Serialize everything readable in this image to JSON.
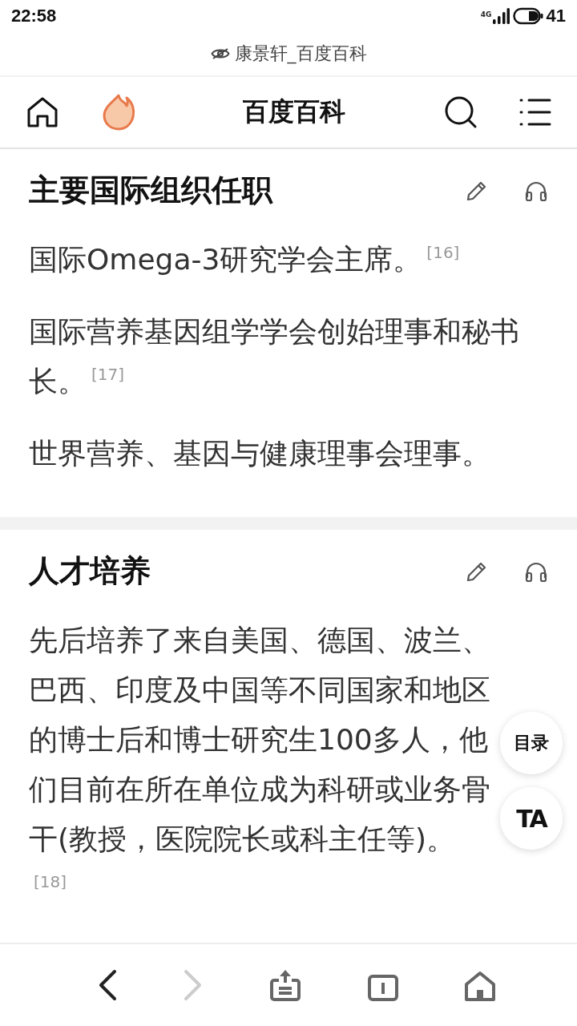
{
  "status_bar": {
    "time": "22:58",
    "network": "4G",
    "battery": "41"
  },
  "page_title": "康景轩_百度百科",
  "nav": {
    "title": "百度百科"
  },
  "sections": [
    {
      "heading": "主要国际组织任职",
      "paragraphs": [
        "国际Omega-3研究学会主席。$^{[16]}$",
        "国际营养基因组学学会创始理事和秘书长。$^{[17]}$",
        "世界营养、基因与健康理事会理事。"
      ]
    },
    {
      "heading": "人才培养",
      "paragraphs": [
        "先后培养了来自美国、德国、波兰、巴西、印度及中国等不同国家和地区的博士后和博士研究生100多人，他们目前在所在单位成为科研或业务骨干(教授，医院院长或科主任等)。$^{[18]}$"
      ]
    }
  ],
  "floating_buttons": [
    {
      "kind": "toc",
      "label": "目录"
    },
    {
      "kind": "ta",
      "label": "TA"
    }
  ],
  "bottom_bar": [
    {
      "kind": "back",
      "disabled": false
    },
    {
      "kind": "forward",
      "disabled": true
    },
    {
      "kind": "share",
      "disabled": false
    },
    {
      "kind": "tabs",
      "disabled": false
    },
    {
      "kind": "home",
      "disabled": false
    }
  ]
}
